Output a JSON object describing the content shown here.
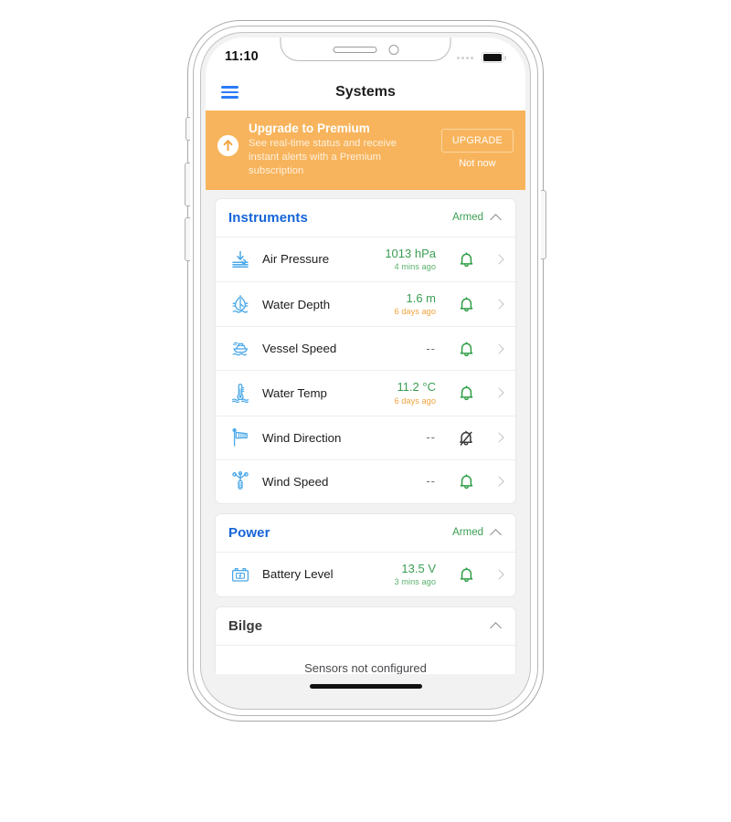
{
  "status_bar": {
    "time": "11:10",
    "signal_icon": "signal-dots-icon",
    "battery_icon": "battery-full-icon"
  },
  "nav": {
    "menu_icon": "hamburger-menu-icon",
    "title": "Systems"
  },
  "promo": {
    "badge_icon": "arrow-up-circle-icon",
    "title": "Upgrade to Premium",
    "subtitle": "See real-time status and receive instant alerts with a Premium subscription",
    "upgrade_label": "UPGRADE",
    "dismiss_label": "Not now",
    "background_color": "#f8b45c"
  },
  "colors": {
    "accent_blue": "#1565d8",
    "icon_blue": "#4aa8e8",
    "ok_green": "#3a9e52",
    "stale_orange": "#f0a33f",
    "muted_gray": "#6e6e73"
  },
  "sections": [
    {
      "title": "Instruments",
      "status": "Armed",
      "collapse_icon": "chevron-up-icon",
      "rows": [
        {
          "icon": "air-pressure-icon",
          "label": "Air Pressure",
          "value": "1013 hPa",
          "value_state": "ok",
          "time": "4 mins ago",
          "time_state": "fresh",
          "alert_icon": "bell-icon",
          "alert_state": "on",
          "chevron_icon": "chevron-right-icon"
        },
        {
          "icon": "water-depth-icon",
          "label": "Water Depth",
          "value": "1.6 m",
          "value_state": "ok",
          "time": "6 days ago",
          "time_state": "stale",
          "alert_icon": "bell-icon",
          "alert_state": "on",
          "chevron_icon": "chevron-right-icon"
        },
        {
          "icon": "vessel-speed-icon",
          "label": "Vessel Speed",
          "value": "--",
          "value_state": "none",
          "time": "",
          "time_state": "none",
          "alert_icon": "bell-icon",
          "alert_state": "on",
          "chevron_icon": "chevron-right-icon"
        },
        {
          "icon": "water-temp-icon",
          "label": "Water Temp",
          "value": "11.2 °C",
          "value_state": "ok",
          "time": "6 days ago",
          "time_state": "stale",
          "alert_icon": "bell-icon",
          "alert_state": "on",
          "chevron_icon": "chevron-right-icon"
        },
        {
          "icon": "wind-direction-icon",
          "label": "Wind Direction",
          "value": "--",
          "value_state": "none",
          "time": "",
          "time_state": "none",
          "alert_icon": "bell-off-icon",
          "alert_state": "off",
          "chevron_icon": "chevron-right-icon"
        },
        {
          "icon": "wind-speed-icon",
          "label": "Wind Speed",
          "value": "--",
          "value_state": "none",
          "time": "",
          "time_state": "none",
          "alert_icon": "bell-icon",
          "alert_state": "on",
          "chevron_icon": "chevron-right-icon"
        }
      ]
    },
    {
      "title": "Power",
      "status": "Armed",
      "collapse_icon": "chevron-up-icon",
      "rows": [
        {
          "icon": "battery-level-icon",
          "label": "Battery Level",
          "value": "13.5 V",
          "value_state": "ok",
          "time": "3 mins ago",
          "time_state": "fresh",
          "alert_icon": "bell-icon",
          "alert_state": "on",
          "chevron_icon": "chevron-right-icon"
        }
      ]
    },
    {
      "title": "Bilge",
      "status": "",
      "collapse_icon": "chevron-up-icon",
      "empty_message": "Sensors not configured",
      "rows": []
    }
  ],
  "home_indicator": "home-indicator-bar"
}
